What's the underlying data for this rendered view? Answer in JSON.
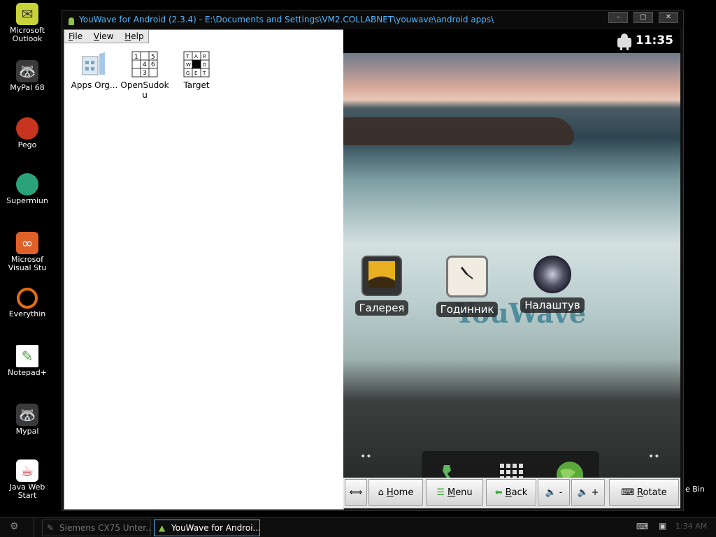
{
  "desktop_icons": [
    {
      "label": "Microsoft\nOutlook",
      "icon": "outlook-icon",
      "color": "#c8d23a"
    },
    {
      "label": "MyPal 68",
      "icon": "mypal-icon",
      "color": "#3a3a3a"
    },
    {
      "label": "Pego",
      "icon": "pego-icon",
      "color": "#c7341f"
    },
    {
      "label": "Supermiun",
      "icon": "supermium-icon",
      "color": "#2aa37a"
    },
    {
      "label": "Microsof\nVisual Stu",
      "icon": "visual-studio-icon",
      "color": "#e0602a"
    },
    {
      "label": "Everythin",
      "icon": "everything-icon",
      "color": "#e46c12"
    },
    {
      "label": "Notepad+",
      "icon": "notepad-plus-icon",
      "color": "#4a9d3a"
    },
    {
      "label": "Mypal",
      "icon": "mypal-icon",
      "color": "#3a3a3a"
    },
    {
      "label": "Java Web\nStart",
      "icon": "java-icon",
      "color": "#b33"
    }
  ],
  "desktop_right_label": "e Bin",
  "window": {
    "title": "YouWave for Android (2.3.4) - E:\\Documents and Settings\\VM2.COLLABNET\\youwave\\android apps\\",
    "menu": [
      "File",
      "View",
      "Help"
    ],
    "apps": [
      {
        "label": "Apps Org...",
        "icon": "apps-organizer-icon"
      },
      {
        "label": "OpenSudok\nu",
        "icon": "sudoku-icon"
      },
      {
        "label": "Target",
        "icon": "target-icon"
      }
    ]
  },
  "android": {
    "clock": "11:35",
    "watermark": "YouWave",
    "home_icons": [
      {
        "label": "Галерея",
        "icon": "gallery-icon"
      },
      {
        "label": "Годинник",
        "icon": "clock-icon"
      },
      {
        "label": "Налаштув",
        "icon": "settings-icon"
      }
    ],
    "dock": [
      "phone-icon",
      "app-drawer-icon",
      "browser-icon"
    ]
  },
  "navbar": {
    "home": "Home",
    "menu": "Menu",
    "back": "Back",
    "vol_down": "-",
    "vol_up": "+",
    "rotate": "Rotate"
  },
  "taskbar": {
    "items": [
      {
        "label": "Siemens CX75 Unter..."
      },
      {
        "label": "YouWave for Androi..."
      }
    ],
    "time": "1:34 AM"
  }
}
